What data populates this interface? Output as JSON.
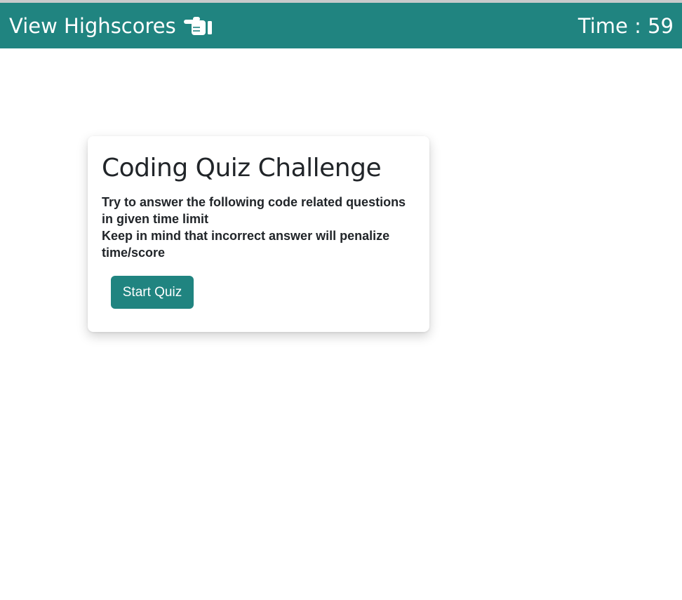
{
  "header": {
    "highscores_label": "View Highscores",
    "timer_text": "Time : 59",
    "background_color": "#208480"
  },
  "icons": {
    "highscores_icon": "pointing-hand-icon"
  },
  "card": {
    "title": "Coding Quiz Challenge",
    "description_lines": [
      "Try to answer the following code related questions in given time limit",
      "Keep in mind that incorrect answer will penalize time/score"
    ],
    "start_button_label": "Start Quiz"
  },
  "colors": {
    "accent": "#208480",
    "text": "#212529"
  }
}
